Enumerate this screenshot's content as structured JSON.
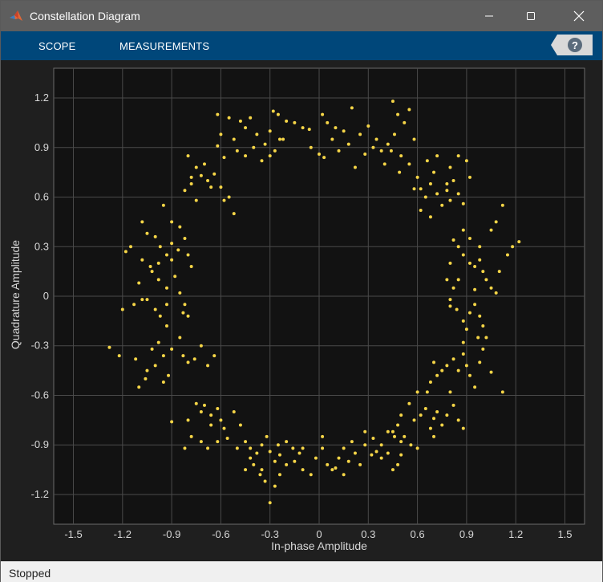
{
  "window": {
    "title": "Constellation Diagram",
    "controls": [
      "minimize-icon",
      "maximize-icon",
      "close-icon"
    ]
  },
  "toolstrip": {
    "tabs": [
      {
        "label": "SCOPE"
      },
      {
        "label": "MEASUREMENTS"
      }
    ],
    "help_icon": "help-icon"
  },
  "status": {
    "text": "Stopped"
  },
  "colors": {
    "titlebar": "#5e5e5e",
    "toolstrip": "#00477a",
    "plot_background": "#121212",
    "grid": "#4a4a4a",
    "points": "#f5d547",
    "axis_text": "#d8d8d8"
  },
  "chart_data": {
    "type": "scatter",
    "xlabel": "In-phase Amplitude",
    "ylabel": "Quadrature Amplitude",
    "xlim": [
      -1.62,
      1.62
    ],
    "ylim": [
      -1.38,
      1.38
    ],
    "xticks": [
      -1.5,
      -1.2,
      -0.9,
      -0.6,
      -0.3,
      0,
      0.3,
      0.6,
      0.9,
      1.2,
      1.5
    ],
    "yticks": [
      -1.2,
      -0.9,
      -0.6,
      -0.3,
      0,
      0.3,
      0.6,
      0.9,
      1.2
    ],
    "xtick_labels": [
      "-1.5",
      "-1.2",
      "-0.9",
      "-0.6",
      "-0.3",
      "0",
      "0.3",
      "0.6",
      "0.9",
      "1.2",
      "1.5"
    ],
    "ytick_labels": [
      "-1.2",
      "-0.9",
      "-0.6",
      "-0.3",
      "0",
      "0.3",
      "0.6",
      "0.9",
      "1.2"
    ],
    "grid": true,
    "points": [
      [
        -0.62,
        1.1
      ],
      [
        -0.55,
        1.08
      ],
      [
        -0.48,
        1.06
      ],
      [
        -0.6,
        0.98
      ],
      [
        -0.52,
        0.95
      ],
      [
        -0.45,
        1.02
      ],
      [
        -0.4,
        0.9
      ],
      [
        -0.38,
        0.98
      ],
      [
        -0.42,
        1.08
      ],
      [
        -0.33,
        0.92
      ],
      [
        -0.3,
        1.0
      ],
      [
        -0.28,
        1.12
      ],
      [
        -0.25,
        1.1
      ],
      [
        -0.2,
        1.06
      ],
      [
        -0.15,
        1.05
      ],
      [
        -0.1,
        1.02
      ],
      [
        -0.06,
        1.01
      ],
      [
        -0.22,
        0.95
      ],
      [
        -0.35,
        0.82
      ],
      [
        -0.45,
        0.85
      ],
      [
        -0.5,
        0.88
      ],
      [
        -0.58,
        0.84
      ],
      [
        -0.62,
        0.91
      ],
      [
        -0.3,
        0.85
      ],
      [
        -0.27,
        0.88
      ],
      [
        -0.24,
        0.95
      ],
      [
        0.02,
        1.1
      ],
      [
        0.05,
        1.05
      ],
      [
        0.1,
        1.02
      ],
      [
        0.15,
        1.0
      ],
      [
        0.2,
        1.14
      ],
      [
        0.25,
        0.98
      ],
      [
        0.3,
        1.03
      ],
      [
        0.35,
        0.95
      ],
      [
        0.38,
        0.88
      ],
      [
        0.42,
        0.92
      ],
      [
        0.45,
        1.18
      ],
      [
        0.48,
        1.1
      ],
      [
        0.52,
        1.05
      ],
      [
        0.55,
        1.13
      ],
      [
        0.58,
        0.95
      ],
      [
        0.5,
        0.85
      ],
      [
        0.4,
        0.8
      ],
      [
        0.33,
        0.9
      ],
      [
        0.28,
        0.86
      ],
      [
        0.22,
        0.78
      ],
      [
        0.18,
        0.92
      ],
      [
        0.12,
        0.88
      ],
      [
        0.08,
        0.95
      ],
      [
        0.03,
        0.84
      ],
      [
        0.0,
        0.86
      ],
      [
        -0.05,
        0.9
      ],
      [
        0.46,
        0.98
      ],
      [
        0.44,
        0.88
      ],
      [
        0.49,
        0.75
      ],
      [
        -0.8,
        0.85
      ],
      [
        -0.78,
        0.72
      ],
      [
        -0.75,
        0.78
      ],
      [
        -0.72,
        0.73
      ],
      [
        -0.7,
        0.8
      ],
      [
        -0.68,
        0.7
      ],
      [
        -0.66,
        0.66
      ],
      [
        -0.64,
        0.74
      ],
      [
        -0.6,
        0.66
      ],
      [
        -0.58,
        0.58
      ],
      [
        -0.82,
        0.64
      ],
      [
        -0.75,
        0.58
      ],
      [
        -0.78,
        0.68
      ],
      [
        -0.55,
        0.6
      ],
      [
        -0.52,
        0.5
      ],
      [
        -1.08,
        0.45
      ],
      [
        -1.05,
        0.38
      ],
      [
        -1.0,
        0.36
      ],
      [
        -0.97,
        0.3
      ],
      [
        -0.93,
        0.25
      ],
      [
        -0.9,
        0.32
      ],
      [
        -0.86,
        0.28
      ],
      [
        -0.82,
        0.35
      ],
      [
        -0.8,
        0.25
      ],
      [
        -0.78,
        0.18
      ],
      [
        -0.95,
        0.55
      ],
      [
        -0.9,
        0.45
      ],
      [
        -0.85,
        0.42
      ],
      [
        -1.02,
        0.15
      ],
      [
        -0.98,
        0.1
      ],
      [
        -0.93,
        0.05
      ],
      [
        -0.88,
        0.12
      ],
      [
        -0.85,
        0.02
      ],
      [
        -0.82,
        -0.05
      ],
      [
        -0.8,
        -0.12
      ],
      [
        -1.1,
        0.08
      ],
      [
        -1.05,
        -0.02
      ],
      [
        -1.0,
        -0.08
      ],
      [
        -0.97,
        -0.12
      ],
      [
        -0.93,
        -0.18
      ],
      [
        -1.13,
        -0.05
      ],
      [
        -1.2,
        -0.08
      ],
      [
        -1.18,
        0.27
      ],
      [
        -1.15,
        0.3
      ],
      [
        -1.08,
        0.22
      ],
      [
        -1.03,
        0.18
      ],
      [
        -0.98,
        0.2
      ],
      [
        -0.9,
        0.22
      ],
      [
        -0.93,
        -0.05
      ],
      [
        -0.83,
        -0.1
      ],
      [
        -1.08,
        -0.02
      ],
      [
        -1.28,
        -0.31
      ],
      [
        -1.22,
        -0.36
      ],
      [
        -1.12,
        -0.38
      ],
      [
        -1.05,
        -0.45
      ],
      [
        -1.0,
        -0.42
      ],
      [
        -0.95,
        -0.36
      ],
      [
        -0.9,
        -0.32
      ],
      [
        -0.85,
        -0.25
      ],
      [
        -0.83,
        -0.36
      ],
      [
        -0.8,
        -0.4
      ],
      [
        -0.76,
        -0.38
      ],
      [
        -0.72,
        -0.3
      ],
      [
        -0.68,
        -0.42
      ],
      [
        -0.64,
        -0.36
      ],
      [
        -1.1,
        -0.55
      ],
      [
        -1.06,
        -0.5
      ],
      [
        -0.95,
        -0.52
      ],
      [
        -0.92,
        -0.48
      ],
      [
        -1.02,
        -0.32
      ],
      [
        -0.98,
        -0.28
      ],
      [
        -0.75,
        -0.65
      ],
      [
        -0.72,
        -0.7
      ],
      [
        -0.7,
        -0.66
      ],
      [
        -0.66,
        -0.72
      ],
      [
        -0.62,
        -0.68
      ],
      [
        -0.6,
        -0.75
      ],
      [
        -0.58,
        -0.8
      ],
      [
        -0.56,
        -0.86
      ],
      [
        -0.52,
        -0.7
      ],
      [
        -0.48,
        -0.78
      ],
      [
        -0.8,
        -0.75
      ],
      [
        -0.78,
        -0.85
      ],
      [
        -0.72,
        -0.88
      ],
      [
        -0.68,
        -0.92
      ],
      [
        -0.62,
        -0.88
      ],
      [
        -0.9,
        -0.76
      ],
      [
        -0.82,
        -0.92
      ],
      [
        -0.66,
        -0.78
      ],
      [
        -0.5,
        -0.92
      ],
      [
        -0.45,
        -0.88
      ],
      [
        -0.42,
        -0.98
      ],
      [
        -0.38,
        -0.95
      ],
      [
        -0.35,
        -0.9
      ],
      [
        -0.32,
        -0.85
      ],
      [
        -0.3,
        -0.94
      ],
      [
        -0.27,
        -1.0
      ],
      [
        -0.24,
        -0.96
      ],
      [
        -0.2,
        -0.88
      ],
      [
        -0.16,
        -0.92
      ],
      [
        -0.12,
        -0.95
      ],
      [
        -0.1,
        -1.05
      ],
      [
        -0.05,
        -1.08
      ],
      [
        -0.02,
        -0.98
      ],
      [
        -0.45,
        -1.05
      ],
      [
        -0.4,
        -1.02
      ],
      [
        -0.36,
        -1.08
      ],
      [
        -0.33,
        -1.12
      ],
      [
        -0.3,
        -1.25
      ],
      [
        -0.27,
        -1.15
      ],
      [
        -0.24,
        -1.08
      ],
      [
        -0.2,
        -1.02
      ],
      [
        -0.15,
        -1.0
      ],
      [
        -0.1,
        -0.92
      ],
      [
        -0.35,
        -1.05
      ],
      [
        -0.25,
        -0.9
      ],
      [
        -0.42,
        -0.92
      ],
      [
        0.02,
        -0.85
      ],
      [
        0.05,
        -1.02
      ],
      [
        0.08,
        -1.05
      ],
      [
        0.12,
        -0.98
      ],
      [
        0.15,
        -0.92
      ],
      [
        0.18,
        -1.0
      ],
      [
        0.22,
        -0.95
      ],
      [
        0.25,
        -1.02
      ],
      [
        0.28,
        -0.9
      ],
      [
        0.32,
        -0.96
      ],
      [
        0.35,
        -0.94
      ],
      [
        0.38,
        -0.98
      ],
      [
        0.42,
        -0.95
      ],
      [
        0.45,
        -1.05
      ],
      [
        0.48,
        -1.02
      ],
      [
        0.5,
        -0.96
      ],
      [
        0.5,
        -0.88
      ],
      [
        0.46,
        -0.85
      ],
      [
        0.42,
        -0.82
      ],
      [
        0.38,
        -0.9
      ],
      [
        0.33,
        -0.86
      ],
      [
        0.28,
        -0.82
      ],
      [
        0.2,
        -0.88
      ],
      [
        0.15,
        -1.08
      ],
      [
        0.1,
        -1.04
      ],
      [
        0.02,
        -0.92
      ],
      [
        0.55,
        -0.65
      ],
      [
        0.5,
        -0.72
      ],
      [
        0.48,
        -0.78
      ],
      [
        0.45,
        -0.82
      ],
      [
        0.52,
        -0.85
      ],
      [
        0.56,
        -0.9
      ],
      [
        0.6,
        -0.92
      ],
      [
        0.62,
        -0.72
      ],
      [
        0.65,
        -0.68
      ],
      [
        0.7,
        -0.74
      ],
      [
        0.72,
        -0.7
      ],
      [
        0.75,
        -0.78
      ],
      [
        0.78,
        -0.72
      ],
      [
        0.82,
        -0.66
      ],
      [
        0.85,
        -0.75
      ],
      [
        0.88,
        -0.8
      ],
      [
        0.7,
        -0.85
      ],
      [
        0.68,
        -0.8
      ],
      [
        0.6,
        -0.58
      ],
      [
        0.58,
        -0.75
      ],
      [
        0.7,
        -0.4
      ],
      [
        0.75,
        -0.45
      ],
      [
        0.78,
        -0.42
      ],
      [
        0.82,
        -0.38
      ],
      [
        0.85,
        -0.45
      ],
      [
        0.88,
        -0.35
      ],
      [
        0.9,
        -0.42
      ],
      [
        0.92,
        -0.48
      ],
      [
        0.95,
        -0.55
      ],
      [
        0.98,
        -0.4
      ],
      [
        1.0,
        -0.32
      ],
      [
        1.05,
        -0.46
      ],
      [
        1.12,
        -0.58
      ],
      [
        0.72,
        -0.48
      ],
      [
        0.68,
        -0.52
      ],
      [
        0.66,
        -0.58
      ],
      [
        0.8,
        -0.58
      ],
      [
        0.88,
        -0.28
      ],
      [
        0.85,
        0.3
      ],
      [
        0.88,
        0.25
      ],
      [
        0.92,
        0.2
      ],
      [
        0.95,
        0.18
      ],
      [
        0.98,
        0.22
      ],
      [
        1.0,
        0.15
      ],
      [
        1.02,
        0.1
      ],
      [
        1.05,
        0.05
      ],
      [
        1.08,
        0.02
      ],
      [
        1.1,
        0.15
      ],
      [
        1.15,
        0.25
      ],
      [
        0.85,
        0.1
      ],
      [
        0.82,
        0.05
      ],
      [
        0.8,
        -0.02
      ],
      [
        0.84,
        -0.08
      ],
      [
        0.88,
        -0.15
      ],
      [
        0.9,
        -0.2
      ],
      [
        0.92,
        -0.1
      ],
      [
        0.95,
        -0.05
      ],
      [
        0.98,
        -0.12
      ],
      [
        1.0,
        -0.18
      ],
      [
        1.02,
        -0.25
      ],
      [
        0.88,
        0.4
      ],
      [
        0.92,
        0.35
      ],
      [
        0.98,
        0.3
      ],
      [
        1.05,
        0.4
      ],
      [
        1.08,
        0.45
      ],
      [
        1.12,
        0.55
      ],
      [
        1.18,
        0.3
      ],
      [
        1.22,
        0.33
      ],
      [
        0.82,
        0.34
      ],
      [
        0.8,
        0.2
      ],
      [
        0.78,
        0.1
      ],
      [
        0.8,
        -0.06
      ],
      [
        0.95,
        0.04
      ],
      [
        0.97,
        -0.25
      ],
      [
        0.6,
        0.72
      ],
      [
        0.62,
        0.65
      ],
      [
        0.65,
        0.6
      ],
      [
        0.68,
        0.68
      ],
      [
        0.7,
        0.75
      ],
      [
        0.72,
        0.62
      ],
      [
        0.75,
        0.55
      ],
      [
        0.78,
        0.64
      ],
      [
        0.8,
        0.58
      ],
      [
        0.82,
        0.7
      ],
      [
        0.85,
        0.62
      ],
      [
        0.88,
        0.56
      ],
      [
        0.9,
        0.82
      ],
      [
        0.85,
        0.85
      ],
      [
        0.8,
        0.78
      ],
      [
        0.72,
        0.85
      ],
      [
        0.66,
        0.82
      ],
      [
        0.58,
        0.65
      ],
      [
        0.62,
        0.52
      ],
      [
        0.68,
        0.48
      ],
      [
        0.92,
        0.72
      ],
      [
        0.78,
        0.68
      ],
      [
        0.55,
        0.8
      ]
    ]
  }
}
